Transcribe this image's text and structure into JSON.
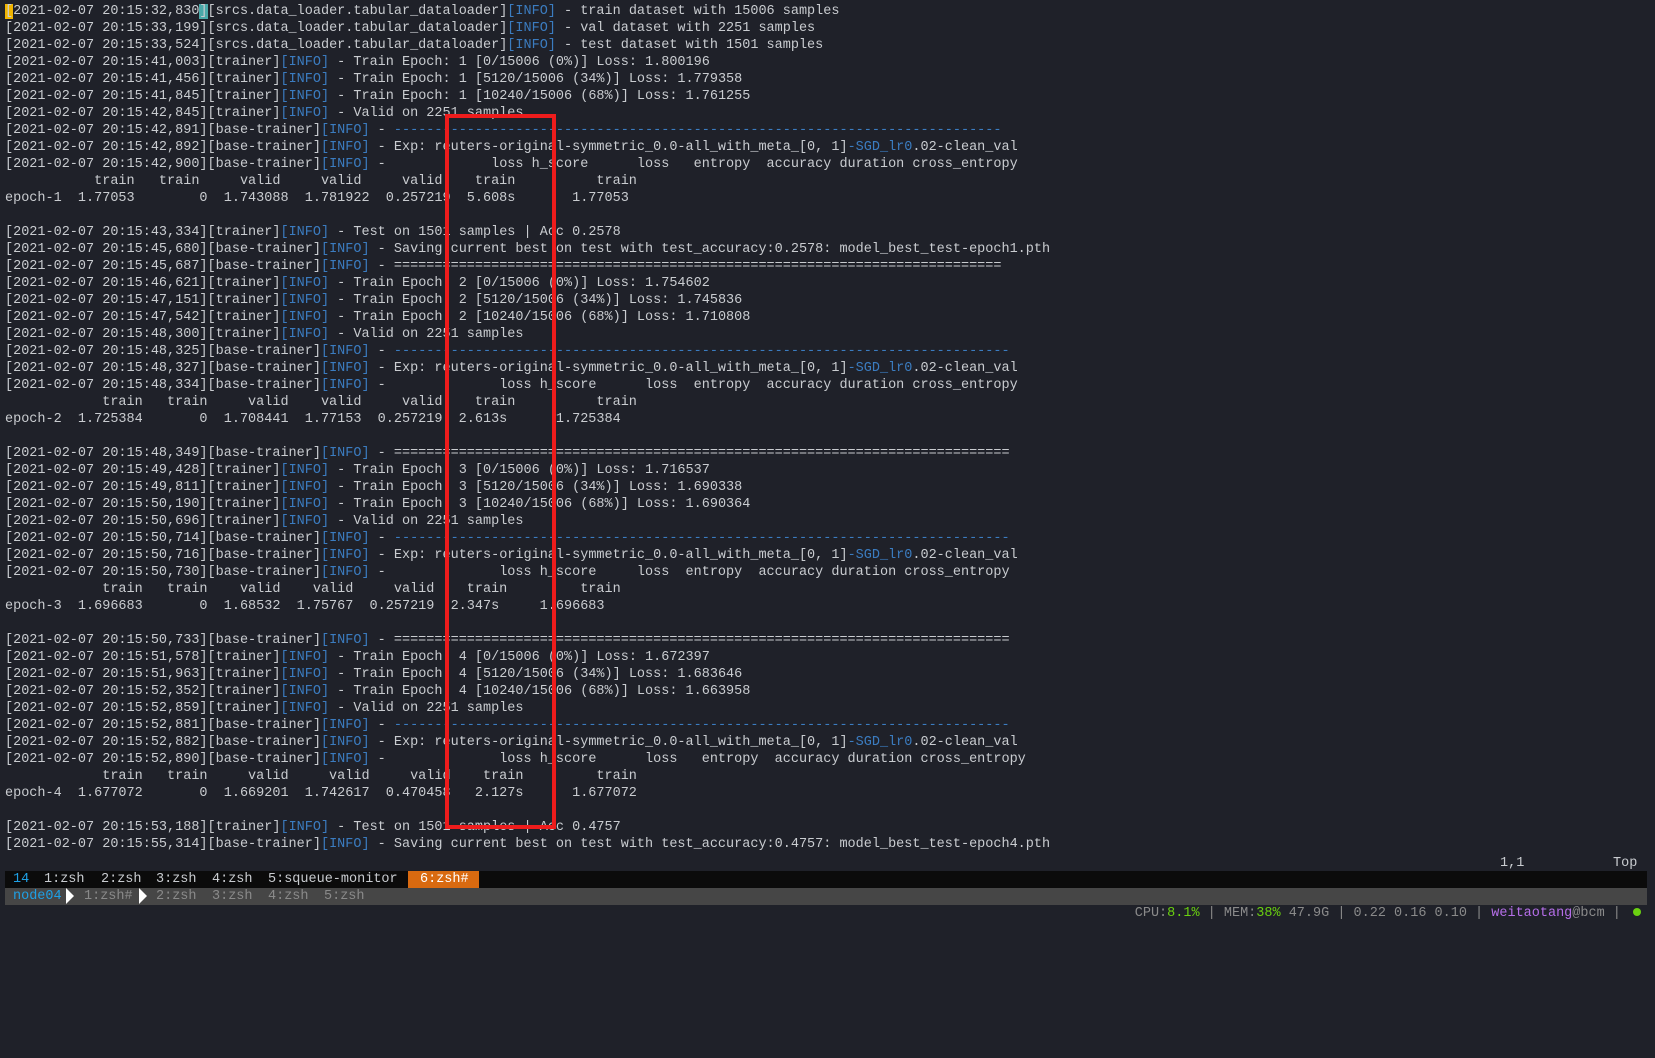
{
  "log_lines": [
    {
      "ts": "[2021-02-07 20:15:32,830]",
      "src": "[srcs.data_loader.tabular_dataloader]",
      "level": "[INFO]",
      "msg": " - train dataset with 15006 samples"
    },
    {
      "ts": "[2021-02-07 20:15:33,199]",
      "src": "[srcs.data_loader.tabular_dataloader]",
      "level": "[INFO]",
      "msg": " - val dataset with 2251 samples"
    },
    {
      "ts": "[2021-02-07 20:15:33,524]",
      "src": "[srcs.data_loader.tabular_dataloader]",
      "level": "[INFO]",
      "msg": " - test dataset with 1501 samples"
    },
    {
      "ts": "[2021-02-07 20:15:41,003]",
      "src": "[trainer]",
      "level": "[INFO]",
      "msg": " - Train Epoch: 1 [0/15006 (0%)] Loss: 1.800196"
    },
    {
      "ts": "[2021-02-07 20:15:41,456]",
      "src": "[trainer]",
      "level": "[INFO]",
      "msg": " - Train Epoch: 1 [5120/15006 (34%)] Loss: 1.779358"
    },
    {
      "ts": "[2021-02-07 20:15:41,845]",
      "src": "[trainer]",
      "level": "[INFO]",
      "msg": " - Train Epoch: 1 [10240/15006 (68%)] Loss: 1.761255"
    },
    {
      "ts": "[2021-02-07 20:15:42,845]",
      "src": "[trainer]",
      "level": "[INFO]",
      "msg": " - Valid on 2251 samples"
    },
    {
      "ts": "[2021-02-07 20:15:42,891]",
      "src": "[base-trainer]",
      "level": "[INFO]",
      "msg": " - ",
      "accent": "---------------------------------------------------------------------------"
    },
    {
      "ts": "[2021-02-07 20:15:42,892]",
      "src": "[base-trainer]",
      "level": "[INFO]",
      "msg": " - Exp: reuters-original-symmetric_0.0-all_with_meta_[0, 1]",
      "accent": "-SGD_lr0",
      "tail": ".02-clean_val"
    },
    {
      "ts": "[2021-02-07 20:15:42,900]",
      "src": "[base-trainer]",
      "level": "[INFO]",
      "msg": " -             loss h_score      loss   entropy  accuracy duration cross_entropy"
    },
    {
      "raw": "           train   train     valid     valid     valid    train          train"
    },
    {
      "raw": "epoch-1  1.77053        0  1.743088  1.781922  0.257219  5.608s       1.77053"
    },
    {
      "raw": ""
    },
    {
      "ts": "[2021-02-07 20:15:43,334]",
      "src": "[trainer]",
      "level": "[INFO]",
      "msg": " - Test on 1501 samples | Acc 0.2578"
    },
    {
      "ts": "[2021-02-07 20:15:45,680]",
      "src": "[base-trainer]",
      "level": "[INFO]",
      "msg": " - Saving current best on test with test_accuracy:0.2578: model_best_test-epoch1.pth"
    },
    {
      "ts": "[2021-02-07 20:15:45,687]",
      "src": "[base-trainer]",
      "level": "[INFO]",
      "msg": " - ==========================================================================="
    },
    {
      "ts": "[2021-02-07 20:15:46,621]",
      "src": "[trainer]",
      "level": "[INFO]",
      "msg": " - Train Epoch: 2 [0/15006 (0%)] Loss: 1.754602"
    },
    {
      "ts": "[2021-02-07 20:15:47,151]",
      "src": "[trainer]",
      "level": "[INFO]",
      "msg": " - Train Epoch: 2 [5120/15006 (34%)] Loss: 1.745836"
    },
    {
      "ts": "[2021-02-07 20:15:47,542]",
      "src": "[trainer]",
      "level": "[INFO]",
      "msg": " - Train Epoch: 2 [10240/15006 (68%)] Loss: 1.710808"
    },
    {
      "ts": "[2021-02-07 20:15:48,300]",
      "src": "[trainer]",
      "level": "[INFO]",
      "msg": " - Valid on 2251 samples"
    },
    {
      "ts": "[2021-02-07 20:15:48,325]",
      "src": "[base-trainer]",
      "level": "[INFO]",
      "msg": " - ",
      "accent": "----------------------------------------------------------------------------"
    },
    {
      "ts": "[2021-02-07 20:15:48,327]",
      "src": "[base-trainer]",
      "level": "[INFO]",
      "msg": " - Exp: reuters-original-symmetric_0.0-all_with_meta_[0, 1]",
      "accent": "-SGD_lr0",
      "tail": ".02-clean_val"
    },
    {
      "ts": "[2021-02-07 20:15:48,334]",
      "src": "[base-trainer]",
      "level": "[INFO]",
      "msg": " -              loss h_score      loss  entropy  accuracy duration cross_entropy"
    },
    {
      "raw": "            train   train     valid    valid     valid    train          train"
    },
    {
      "raw": "epoch-2  1.725384       0  1.708441  1.77153  0.257219  2.613s      1.725384"
    },
    {
      "raw": ""
    },
    {
      "ts": "[2021-02-07 20:15:48,349]",
      "src": "[base-trainer]",
      "level": "[INFO]",
      "msg": " - ============================================================================"
    },
    {
      "ts": "[2021-02-07 20:15:49,428]",
      "src": "[trainer]",
      "level": "[INFO]",
      "msg": " - Train Epoch: 3 [0/15006 (0%)] Loss: 1.716537"
    },
    {
      "ts": "[2021-02-07 20:15:49,811]",
      "src": "[trainer]",
      "level": "[INFO]",
      "msg": " - Train Epoch: 3 [5120/15006 (34%)] Loss: 1.690338"
    },
    {
      "ts": "[2021-02-07 20:15:50,190]",
      "src": "[trainer]",
      "level": "[INFO]",
      "msg": " - Train Epoch: 3 [10240/15006 (68%)] Loss: 1.690364"
    },
    {
      "ts": "[2021-02-07 20:15:50,696]",
      "src": "[trainer]",
      "level": "[INFO]",
      "msg": " - Valid on 2251 samples"
    },
    {
      "ts": "[2021-02-07 20:15:50,714]",
      "src": "[base-trainer]",
      "level": "[INFO]",
      "msg": " - ",
      "accent": "----------------------------------------------------------------------------"
    },
    {
      "ts": "[2021-02-07 20:15:50,716]",
      "src": "[base-trainer]",
      "level": "[INFO]",
      "msg": " - Exp: reuters-original-symmetric_0.0-all_with_meta_[0, 1]",
      "accent": "-SGD_lr0",
      "tail": ".02-clean_val"
    },
    {
      "ts": "[2021-02-07 20:15:50,730]",
      "src": "[base-trainer]",
      "level": "[INFO]",
      "msg": " -              loss h_score     loss  entropy  accuracy duration cross_entropy"
    },
    {
      "raw": "            train   train    valid    valid     valid    train         train"
    },
    {
      "raw": "epoch-3  1.696683       0  1.68532  1.75767  0.257219  2.347s     1.696683"
    },
    {
      "raw": ""
    },
    {
      "ts": "[2021-02-07 20:15:50,733]",
      "src": "[base-trainer]",
      "level": "[INFO]",
      "msg": " - ============================================================================"
    },
    {
      "ts": "[2021-02-07 20:15:51,578]",
      "src": "[trainer]",
      "level": "[INFO]",
      "msg": " - Train Epoch: 4 [0/15006 (0%)] Loss: 1.672397"
    },
    {
      "ts": "[2021-02-07 20:15:51,963]",
      "src": "[trainer]",
      "level": "[INFO]",
      "msg": " - Train Epoch: 4 [5120/15006 (34%)] Loss: 1.683646"
    },
    {
      "ts": "[2021-02-07 20:15:52,352]",
      "src": "[trainer]",
      "level": "[INFO]",
      "msg": " - Train Epoch: 4 [10240/15006 (68%)] Loss: 1.663958"
    },
    {
      "ts": "[2021-02-07 20:15:52,859]",
      "src": "[trainer]",
      "level": "[INFO]",
      "msg": " - Valid on 2251 samples"
    },
    {
      "ts": "[2021-02-07 20:15:52,881]",
      "src": "[base-trainer]",
      "level": "[INFO]",
      "msg": " - ",
      "accent": "----------------------------------------------------------------------------"
    },
    {
      "ts": "[2021-02-07 20:15:52,882]",
      "src": "[base-trainer]",
      "level": "[INFO]",
      "msg": " - Exp: reuters-original-symmetric_0.0-all_with_meta_[0, 1]",
      "accent": "-SGD_lr0",
      "tail": ".02-clean_val"
    },
    {
      "ts": "[2021-02-07 20:15:52,890]",
      "src": "[base-trainer]",
      "level": "[INFO]",
      "msg": " -              loss h_score      loss   entropy  accuracy duration cross_entropy"
    },
    {
      "raw": "            train   train     valid     valid     valid    train         train"
    },
    {
      "raw": "epoch-4  1.677072       0  1.669201  1.742617  0.470458   2.127s      1.677072"
    },
    {
      "raw": ""
    },
    {
      "ts": "[2021-02-07 20:15:53,188]",
      "src": "[trainer]",
      "level": "[INFO]",
      "msg": " - Test on 1501 samples | Acc 0.4757"
    },
    {
      "ts": "[2021-02-07 20:15:55,314]",
      "src": "[base-trainer]",
      "level": "[INFO]",
      "msg": " - Saving current best on test with test_accuracy:0.4757: model_best_test-epoch4.pth"
    }
  ],
  "vim_status": {
    "position": "1,1",
    "scroll": "Top"
  },
  "tmux_top": {
    "session": "14",
    "windows": [
      "1:zsh",
      "2:zsh",
      "3:zsh",
      "4:zsh",
      "5:squeue-monitor"
    ],
    "active_window": "6:zsh#"
  },
  "tmux_bottom": {
    "host": "node04",
    "active_window": "1:zsh#",
    "windows": [
      "2:zsh",
      "3:zsh",
      "4:zsh",
      "5:zsh"
    ]
  },
  "status": {
    "cpu_label": "CPU:",
    "cpu": "8.1%",
    "mem_label": "MEM:",
    "mem": "38%",
    "mem_total": "47.9G",
    "load": "0.22 0.16 0.10",
    "user": "weitaotang",
    "host": "@bcm",
    "sep": " | "
  },
  "colors": {
    "background": "#1f2129",
    "text": "#c9ccd0",
    "info": "#3b7cc0",
    "highlight_box": "#ee1c1c",
    "tmux_active": "#d96a10",
    "ok_green": "#6ad010",
    "user_purple": "#b56ee8"
  }
}
